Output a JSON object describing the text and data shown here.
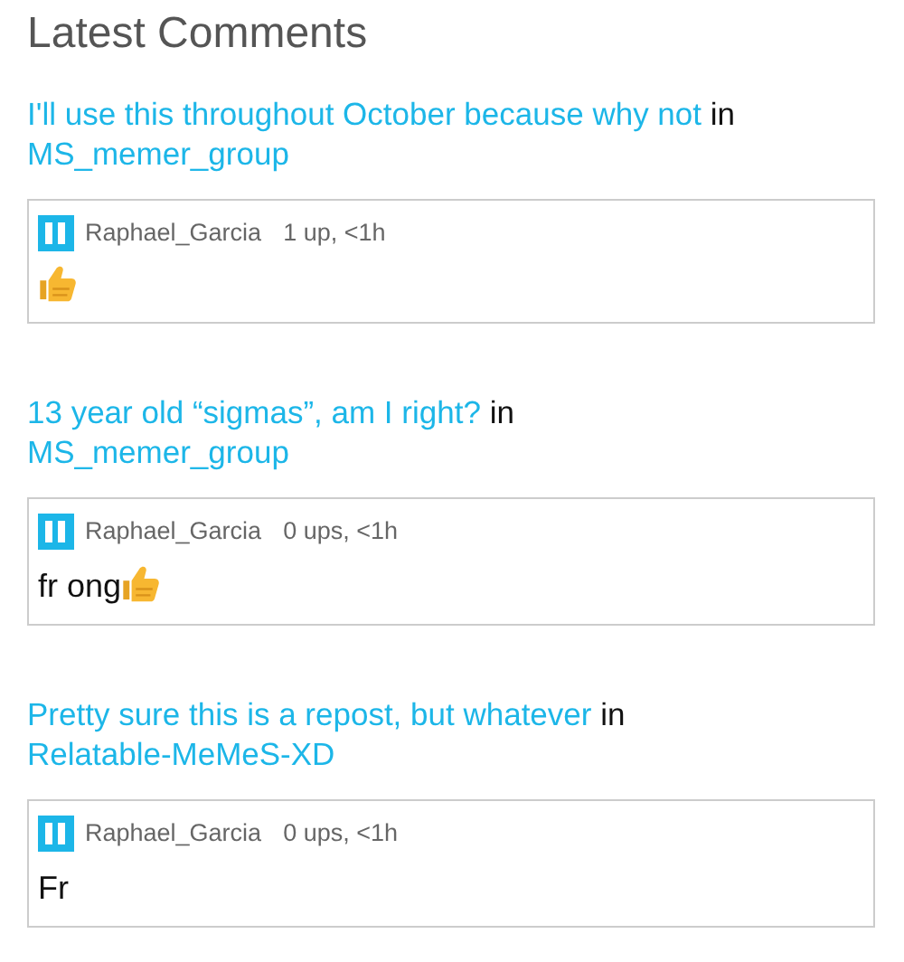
{
  "heading": "Latest Comments",
  "posts": [
    {
      "title": "I'll use this throughout October because why not",
      "joiner": "in",
      "group": "MS_memer_group",
      "comment": {
        "user": "Raphael_Garcia",
        "meta": "1 up, <1h",
        "thumbs_up": true
      }
    },
    {
      "title": "13 year old “sigmas”, am I right?",
      "joiner": "in",
      "group": "MS_memer_group",
      "comment": {
        "user": "Raphael_Garcia",
        "meta": "0 ups, <1h",
        "text": "fr ong",
        "thumbs_up": true
      }
    },
    {
      "title": "Pretty sure this is a repost, but whatever",
      "joiner": "in",
      "group": "Relatable-MeMeS-XD",
      "comment": {
        "user": "Raphael_Garcia",
        "meta": "0 ups, <1h",
        "text": "Fr"
      }
    }
  ]
}
